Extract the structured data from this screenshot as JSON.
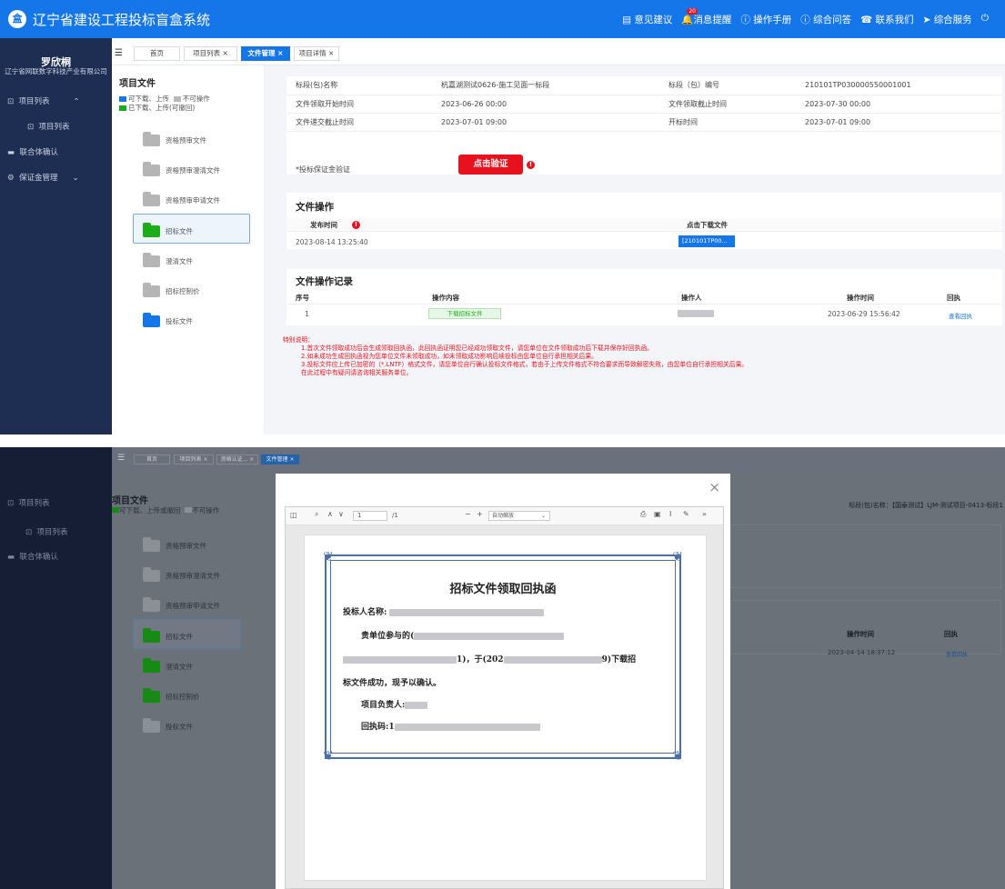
{
  "header": {
    "logo": "盒",
    "title": "辽宁省建设工程投标盲盒系统",
    "menu": [
      "意见建议",
      "消息提醒",
      "操作手册",
      "综合问答",
      "联系我们",
      "综合服务"
    ],
    "badge": "20"
  },
  "sidebar": {
    "user": "罗欣桐",
    "company": "辽宁省网联数字科技产业有限公司",
    "items": [
      "项目列表",
      "项目列表",
      "联合体确认",
      "保证金管理"
    ]
  },
  "tabs": [
    "首页",
    "项目列表 ×",
    "文件管理 ×",
    "项目详情 ×"
  ],
  "file_panel": {
    "title": "项目文件",
    "legend1a": "可下载、上传",
    "legend1b": "不可操作",
    "legend2": "已下载、上传(可撤回)",
    "folders": [
      "资格预审文件",
      "资格预审澄清文件",
      "资格预审申请文件",
      "招标文件",
      "澄清文件",
      "招标控制价",
      "投标文件"
    ]
  },
  "info": {
    "rows": [
      [
        "标段(包)名称",
        "杭嘉湖测试0626-施工见面一标段",
        "标段（包）编号",
        "210101TP030000550001001"
      ],
      [
        "文件领取开始时间",
        "2023-06-26 00:00",
        "文件领取截止时间",
        "2023-07-30 00:00"
      ],
      [
        "文件递交截止时间",
        "2023-07-01 09:00",
        "开标时间",
        "2023-07-01 09:00"
      ]
    ],
    "guarantee_label": "*投标保证金验证",
    "verify_button": "点击验证"
  },
  "file_ops": {
    "title": "文件操作",
    "col_time": "发布时间",
    "col_download": "点击下载文件",
    "time": "2023-08-14 13:25:40",
    "download_label": "[210101TP00..."
  },
  "records": {
    "title": "文件操作记录",
    "headers": [
      "序号",
      "操作内容",
      "操作人",
      "操作时间",
      "回执"
    ],
    "row": {
      "no": "1",
      "content": "下载招标文件",
      "time": "2023-06-29 15:56:42",
      "receipt": "查看回执"
    }
  },
  "notes": [
    "特别说明：",
    "1.首次文件领取成功后会生成领取回执函，此回执函证明您已经成功领取文件，请您单位在文件领取成功后下载并保存好回执函。",
    "2.如未成功生成回执函视为您单位文件未领取成功，如未领取成功影响后续投标由您单位自行承担相关后果。",
    "3.投标文件应上传已加密的（*.LNTF）格式文件，请您单位自行确认投标文件格式，若由于上传文件格式不符合要求而导致解密失败，由您单位自行承担相关后果。",
    "在此过程中有疑问请咨询相关服务单位。"
  ],
  "panel2": {
    "tabs": [
      "首页",
      "项目列表 ×",
      "资格认证... ×",
      "文件管理 ×"
    ],
    "sidebar": [
      "项目列表",
      "项目列表",
      "联合体确认"
    ],
    "title": "项目文件",
    "legend_a": "可下载、上传或撤回",
    "legend_b": "不可操作",
    "folders": [
      "资格预审文件",
      "资格预审澄清文件",
      "资格预审申请文件",
      "招标文件",
      "澄清文件",
      "招标控制价",
      "投标文件"
    ],
    "right_label": "标段(包)名称：【国泰测试】LJM-测试项目-0413-标段1",
    "bg_headers": [
      "操作时间",
      "回执"
    ],
    "bg_time": "2023-04-14 18:37:12",
    "bg_receipt": "查看回执",
    "viewer": {
      "page": "1",
      "pages": "/1",
      "zoom": "自动缩放"
    },
    "cert": {
      "title": "招标文件领取回执函",
      "line1": "投标人名称:",
      "line2": "贵单位参与的(",
      "line3a": "1)，于(202",
      "line3b": "9)下载招",
      "line4": "标文件成功，现予以确认。",
      "line5": "项目负责人:",
      "line6": "回执码:1"
    }
  }
}
